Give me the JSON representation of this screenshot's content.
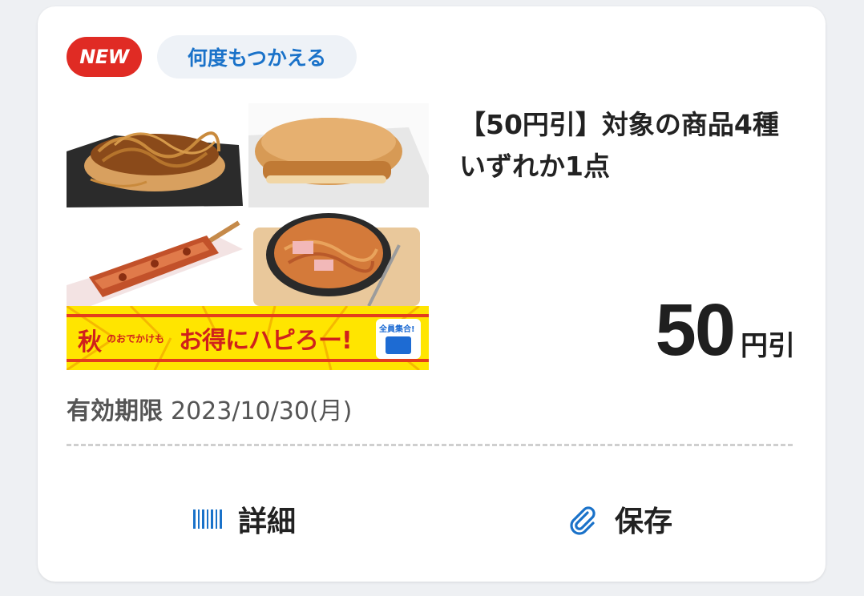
{
  "card": {
    "badge_new": "NEW",
    "badge_reuse": "何度もつかえる",
    "title": "【50円引】対象の商品4種　いずれか1点",
    "discount": {
      "value": "50",
      "unit": "円引"
    },
    "expiry": {
      "label": "有効期限",
      "date": "2023/10/30(月)"
    },
    "banner": {
      "text_left": "秋",
      "text_small": "のおでかけも",
      "text_main": "お得にハピろー!",
      "badge_text": "全員集合!"
    },
    "actions": {
      "details_label": "詳細",
      "save_label": "保存"
    },
    "colors": {
      "new_badge": "#e02b24",
      "reuse_text": "#1a72c9",
      "icon_blue": "#1a72c9",
      "banner_yellow": "#ffe500"
    }
  }
}
